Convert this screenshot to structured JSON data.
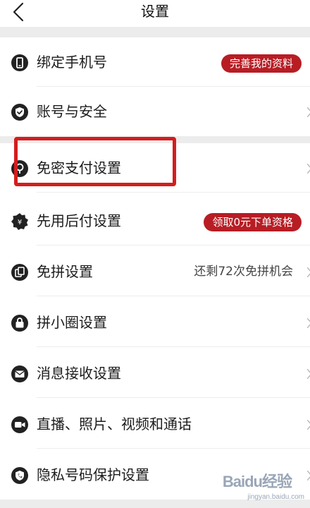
{
  "header": {
    "title": "设置"
  },
  "rows": [
    {
      "label": "绑定手机号",
      "icon": "phone-icon",
      "badge": "完善我的资料"
    },
    {
      "label": "账号与安全",
      "icon": "shield-check-icon"
    },
    {
      "label": "免密支付设置",
      "icon": "payment-icon"
    },
    {
      "label": "先用后付设置",
      "icon": "pay-later-icon",
      "badge": "领取0元下单资格"
    },
    {
      "label": "免拼设置",
      "icon": "card-stack-icon",
      "value": "还剩72次免拼机会"
    },
    {
      "label": "拼小圈设置",
      "icon": "lock-bag-icon"
    },
    {
      "label": "消息接收设置",
      "icon": "mail-icon"
    },
    {
      "label": "直播、照片、视频和通话",
      "icon": "video-camera-icon"
    },
    {
      "label": "隐私号码保护设置",
      "icon": "privacy-shield-phone-icon"
    }
  ],
  "watermark": {
    "logo": "Baidu经验",
    "sub": "jingyan.baidu.com"
  },
  "colors": {
    "badge": "#b81d24",
    "highlight": "#d41d1d",
    "separator": "#ececec"
  }
}
